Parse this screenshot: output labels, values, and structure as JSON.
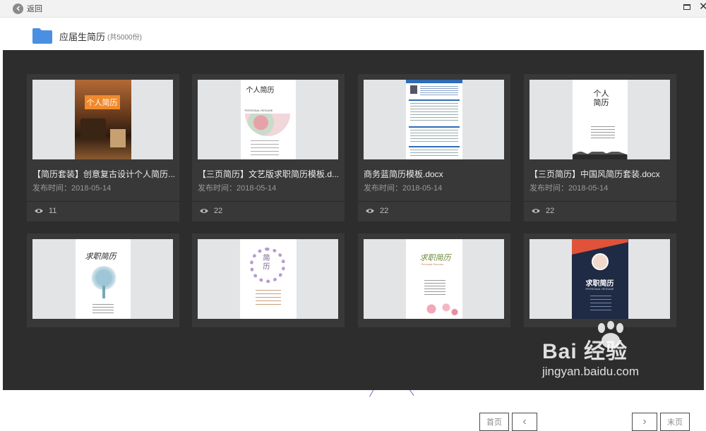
{
  "topbar": {
    "back_label": "返回"
  },
  "folder": {
    "name": "应届生简历",
    "count": "(共5000份)"
  },
  "cards": [
    {
      "title": "【简历套装】创意复古设计个人简历...",
      "date": "发布时间：2018-05-14",
      "views": "11",
      "thumb_text": "个人简历"
    },
    {
      "title": "【三页简历】文艺版求职简历模板.d...",
      "date": "发布时间：2018-05-14",
      "views": "22",
      "thumb_text": "个人简历",
      "thumb_sub": "PERSONAL RESUME"
    },
    {
      "title": "商务蓝简历模板.docx",
      "date": "发布时间：2018-05-14",
      "views": "22"
    },
    {
      "title": "【三页简历】中国风简历套装.docx",
      "date": "发布时间：2018-05-14",
      "views": "22",
      "thumb_text": "个人简历"
    },
    {
      "thumb_text": "求职简历"
    },
    {
      "thumb_text": "简历"
    },
    {
      "thumb_text": "求职简历",
      "thumb_sub": "Personal Resume"
    },
    {
      "thumb_text": "求职简历",
      "thumb_sub": "PERSONAL RESUME"
    }
  ],
  "pagination": {
    "first": "首页",
    "prev": "‹",
    "next": "›",
    "last": "末页"
  },
  "watermark": {
    "brand": "Bai  经验",
    "url": "jingyan.baidu.com"
  },
  "colors": {
    "panel": "#2d2d2d",
    "card": "#383838",
    "folder_blue": "#4a90e2"
  }
}
